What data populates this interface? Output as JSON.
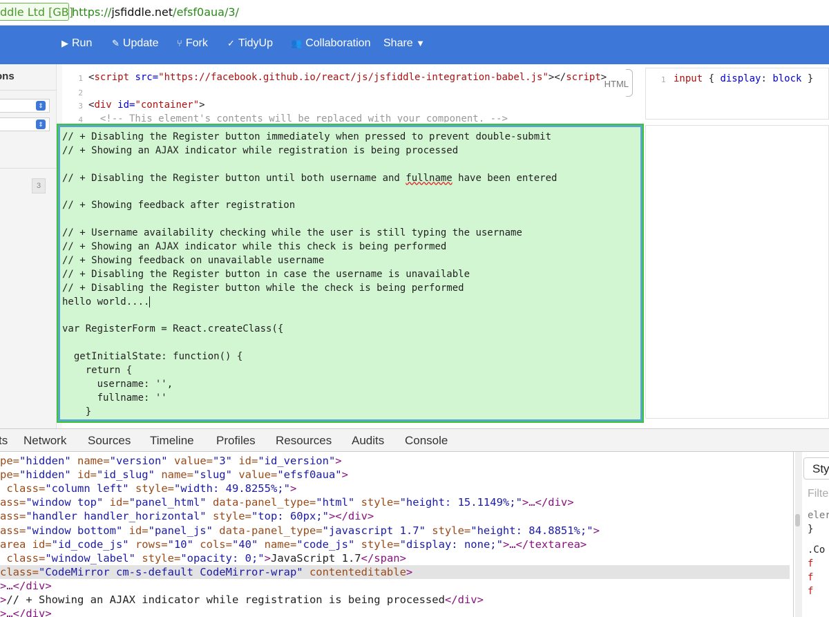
{
  "browser": {
    "ev_label": "ddle Ltd [GB]",
    "url_scheme": "https://",
    "url_host": "jsfiddle.net",
    "url_path": "/efsf0aua/3/"
  },
  "toolbar": {
    "run": "Run",
    "update": "Update",
    "fork": "Fork",
    "tidyup": "TidyUp",
    "collaboration": "Collaboration",
    "share": "Share"
  },
  "sidebar": {
    "label": "ons",
    "badge": "3"
  },
  "html_panel": {
    "label": "HTML",
    "lines": [
      {
        "n": "1",
        "parts": [
          "<",
          "script",
          " src=",
          "\"https://facebook.github.io/react/js/jsfiddle-integration-babel.js\"",
          "></",
          "script",
          ">"
        ]
      },
      {
        "n": "2",
        "parts": []
      },
      {
        "n": "3",
        "parts": [
          "<",
          "div",
          " id=",
          "\"container\"",
          ">"
        ]
      },
      {
        "n": "4",
        "comment": "  <!-- This element's contents will be replaced with your component. -->"
      }
    ]
  },
  "css_panel": {
    "line_number": "1",
    "selector": "input",
    "property": "display",
    "value": "block"
  },
  "js_panel": {
    "lines": [
      "// + Disabling the Register button immediately when pressed to prevent double-submit",
      "// + Showing an AJAX indicator while registration is being processed",
      "",
      "// + Disabling the Register button until both username and fullname have been entered",
      "",
      "// + Showing feedback after registration",
      "",
      "// + Username availability checking while the user is still typing the username",
      "// + Showing an AJAX indicator while this check is being performed",
      "// + Showing feedback on unavailable username",
      "// + Disabling the Register button in case the username is unavailable",
      "// + Disabling the Register button while the check is being performed",
      "hello world....",
      "",
      "var RegisterForm = React.createClass({",
      "",
      "  getInitialState: function() {",
      "    return {",
      "      username: '',",
      "      fullname: ''",
      "    }"
    ],
    "misspelled_word": "fullname"
  },
  "devtools": {
    "tabs": [
      "ts",
      "Network",
      "Sources",
      "Timeline",
      "Profiles",
      "Resources",
      "Audits",
      "Console"
    ],
    "styles_tab": "Sty",
    "filter_placeholder": "Filte",
    "styles_lines": [
      "eler",
      "}",
      ".Co"
    ],
    "dom_lines": [
      [
        [
          "a",
          "pe="
        ],
        [
          "v",
          "\"hidden\""
        ],
        [
          "a",
          " name="
        ],
        [
          "v",
          "\"version\""
        ],
        [
          "a",
          " value="
        ],
        [
          "v",
          "\"3\""
        ],
        [
          "a",
          " id="
        ],
        [
          "v",
          "\"id_version\""
        ],
        [
          "t",
          ">"
        ]
      ],
      [
        [
          "a",
          "pe="
        ],
        [
          "v",
          "\"hidden\""
        ],
        [
          "a",
          " id="
        ],
        [
          "v",
          "\"id_slug\""
        ],
        [
          "a",
          " name="
        ],
        [
          "v",
          "\"slug\""
        ],
        [
          "a",
          " value="
        ],
        [
          "v",
          "\"efsf0aua\""
        ],
        [
          "t",
          ">"
        ]
      ],
      [
        [
          "a",
          " class="
        ],
        [
          "v",
          "\"column left\""
        ],
        [
          "a",
          " style="
        ],
        [
          "v",
          "\"width: 49.8255%;\""
        ],
        [
          "t",
          ">"
        ]
      ],
      [
        [
          "a",
          "ass="
        ],
        [
          "v",
          "\"window top\""
        ],
        [
          "a",
          " id="
        ],
        [
          "v",
          "\"panel_html\""
        ],
        [
          "a",
          " data-panel_type="
        ],
        [
          "v",
          "\"html\""
        ],
        [
          "a",
          " style="
        ],
        [
          "v",
          "\"height: 15.1149%;\""
        ],
        [
          "t",
          ">…</div>"
        ]
      ],
      [
        [
          "a",
          "ass="
        ],
        [
          "v",
          "\"handler handler_horizontal\""
        ],
        [
          "a",
          " style="
        ],
        [
          "v",
          "\"top: 60px;\""
        ],
        [
          "t",
          "></div>"
        ]
      ],
      [
        [
          "a",
          "ass="
        ],
        [
          "v",
          "\"window bottom\""
        ],
        [
          "a",
          " id="
        ],
        [
          "v",
          "\"panel_js\""
        ],
        [
          "a",
          " data-panel_type="
        ],
        [
          "v",
          "\"javascript 1.7\""
        ],
        [
          "a",
          " style="
        ],
        [
          "v",
          "\"height: 84.8851%;\""
        ],
        [
          "t",
          ">"
        ]
      ],
      [
        [
          "a",
          "area id="
        ],
        [
          "v",
          "\"id_code_js\""
        ],
        [
          "a",
          " rows="
        ],
        [
          "v",
          "\"10\""
        ],
        [
          "a",
          " cols="
        ],
        [
          "v",
          "\"40\""
        ],
        [
          "a",
          " name="
        ],
        [
          "v",
          "\"code_js\""
        ],
        [
          "a",
          " style="
        ],
        [
          "v",
          "\"display: none;\""
        ],
        [
          "t",
          ">…</textarea>"
        ]
      ],
      [
        [
          "a",
          " class="
        ],
        [
          "v",
          "\"window_label\""
        ],
        [
          "a",
          " style="
        ],
        [
          "v",
          "\"opacity: 0;\""
        ],
        [
          "t",
          ">"
        ],
        [
          "tx",
          "JavaScript 1.7"
        ],
        [
          "t",
          "</span>"
        ]
      ],
      [
        [
          "a",
          "class="
        ],
        [
          "v",
          "\"CodeMirror cm-s-default CodeMirror-wrap\""
        ],
        [
          "a",
          " contenteditable"
        ],
        [
          "t",
          ">"
        ]
      ],
      [
        [
          "t",
          ">…</div>"
        ]
      ],
      [
        [
          "t",
          ">"
        ],
        [
          "tx",
          "// + Showing an AJAX indicator while registration is being processed"
        ],
        [
          "t",
          "</div>"
        ]
      ],
      [
        [
          "t",
          ">…</div>"
        ]
      ]
    ]
  }
}
